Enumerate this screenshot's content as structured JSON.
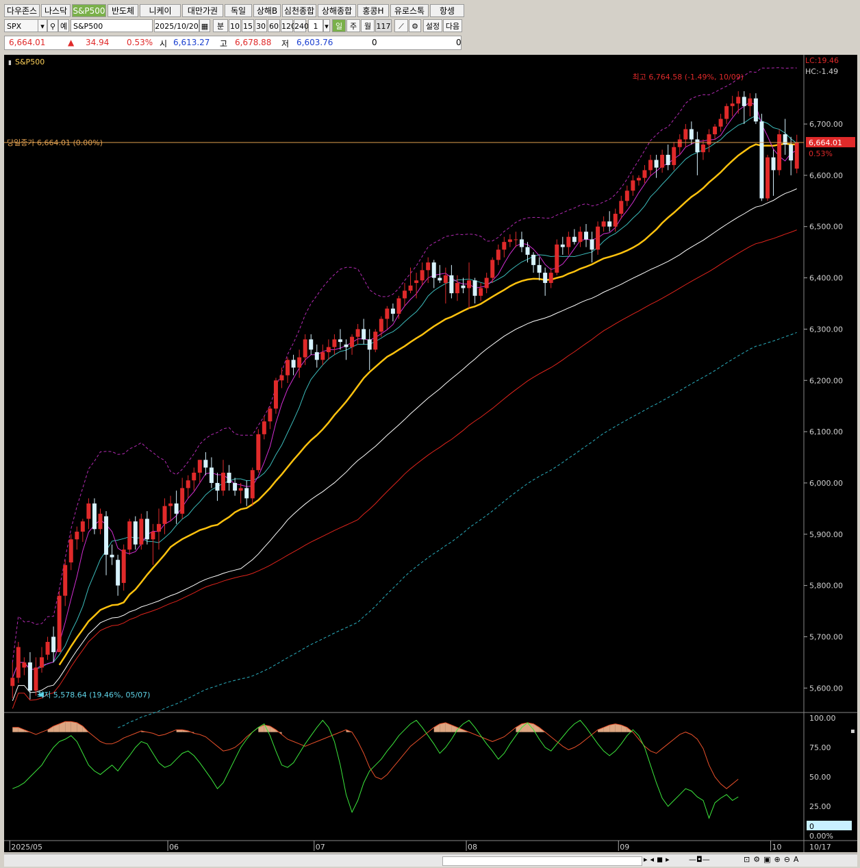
{
  "tabs": [
    "다우존스",
    "나스닥",
    "S&P500",
    "반도체",
    "니케이",
    "대만가권",
    "독일",
    "상해B",
    "심천종합",
    "상해종합",
    "홍콩H",
    "유로스톡",
    "항셍"
  ],
  "active_tab": "S&P500",
  "toolbar": {
    "symbol_code": "SPX",
    "symbol_name": "S&P500",
    "date": "2025/10/20",
    "periods": [
      "분",
      "10",
      "15",
      "30",
      "60",
      "120",
      "240"
    ],
    "period_count": "1",
    "day_label": "일",
    "week_label": "주",
    "month_label": "월",
    "bar_count": "117",
    "settings_label": "설정",
    "next_label": "다음",
    "prefix_label": "예"
  },
  "quote": {
    "price": "6,664.01",
    "change": "34.94",
    "change_pct": "0.53%",
    "open_label": "시",
    "open": "6,613.27",
    "high_label": "고",
    "high": "6,678.88",
    "low_label": "저",
    "low": "6,603.76",
    "vol1": "0",
    "vol2": "0"
  },
  "chart_data": {
    "type": "candlestick",
    "title": "S&P500",
    "lc_label": "LC:19.46",
    "hc_label": "HC:-1.49",
    "max_annotation": "최고 6,764.58 (-1.49%, 10/09)",
    "min_annotation": "최저 5,578.64 (19.46%, 05/07)",
    "close_line_label": "당일종가 6,664.01 (0.00%)",
    "last_price_tag": "6,664.01",
    "last_pct_tag": "0.53%",
    "y_ticks": [
      "6,700.00",
      "6,600.00",
      "6,500.00",
      "6,400.00",
      "6,300.00",
      "6,200.00",
      "6,100.00",
      "6,000.00",
      "5,900.00",
      "5,800.00",
      "5,700.00",
      "5,600.00"
    ],
    "y_tick_values": [
      6700,
      6600,
      6500,
      6400,
      6300,
      6200,
      6100,
      6000,
      5900,
      5800,
      5700,
      5600
    ],
    "ylim": [
      5555,
      6835
    ],
    "x_labels": [
      "2025/05",
      "06",
      "07",
      "08",
      "09",
      "10",
      "10/17"
    ],
    "x_label_index": [
      0,
      27,
      52,
      78,
      104,
      130,
      147
    ],
    "candles": [
      [
        5604,
        5650,
        5580,
        5620
      ],
      [
        5620,
        5690,
        5610,
        5680
      ],
      [
        5640,
        5660,
        5625,
        5650
      ],
      [
        5650,
        5670,
        5578,
        5595
      ],
      [
        5595,
        5660,
        5585,
        5640
      ],
      [
        5640,
        5680,
        5630,
        5660
      ],
      [
        5665,
        5700,
        5655,
        5690
      ],
      [
        5700,
        5720,
        5650,
        5670
      ],
      [
        5670,
        5790,
        5670,
        5780
      ],
      [
        5780,
        5850,
        5760,
        5840
      ],
      [
        5845,
        5900,
        5830,
        5890
      ],
      [
        5890,
        5915,
        5870,
        5905
      ],
      [
        5905,
        5930,
        5885,
        5925
      ],
      [
        5930,
        5970,
        5910,
        5960
      ],
      [
        5960,
        5970,
        5900,
        5910
      ],
      [
        5910,
        5950,
        5900,
        5940
      ],
      [
        5935,
        5945,
        5820,
        5860
      ],
      [
        5860,
        5880,
        5840,
        5855
      ],
      [
        5850,
        5860,
        5780,
        5800
      ],
      [
        5805,
        5880,
        5790,
        5870
      ],
      [
        5870,
        5930,
        5860,
        5925
      ],
      [
        5925,
        5935,
        5870,
        5880
      ],
      [
        5880,
        5940,
        5870,
        5930
      ],
      [
        5930,
        5945,
        5880,
        5890
      ],
      [
        5890,
        5920,
        5840,
        5905
      ],
      [
        5905,
        5950,
        5870,
        5920
      ],
      [
        5920,
        5970,
        5900,
        5955
      ],
      [
        5955,
        5975,
        5925,
        5960
      ],
      [
        5960,
        5985,
        5920,
        5940
      ],
      [
        5940,
        6010,
        5930,
        5990
      ],
      [
        5990,
        6015,
        5970,
        6005
      ],
      [
        6005,
        6030,
        5985,
        6020
      ],
      [
        6020,
        6045,
        6000,
        6045
      ],
      [
        6045,
        6060,
        6015,
        6030
      ],
      [
        6030,
        6050,
        5990,
        6000
      ],
      [
        6000,
        6020,
        5965,
        5985
      ],
      [
        5985,
        6045,
        5975,
        6020
      ],
      [
        6020,
        6035,
        5985,
        6000
      ],
      [
        6000,
        6010,
        5975,
        5985
      ],
      [
        5985,
        6000,
        5960,
        5990
      ],
      [
        5990,
        6005,
        5955,
        5970
      ],
      [
        5970,
        6030,
        5955,
        6025
      ],
      [
        6025,
        6105,
        6020,
        6095
      ],
      [
        6095,
        6130,
        6085,
        6120
      ],
      [
        6120,
        6150,
        6105,
        6145
      ],
      [
        6145,
        6205,
        6135,
        6200
      ],
      [
        6200,
        6225,
        6185,
        6210
      ],
      [
        6210,
        6245,
        6195,
        6240
      ],
      [
        6240,
        6250,
        6210,
        6225
      ],
      [
        6225,
        6260,
        6205,
        6245
      ],
      [
        6245,
        6290,
        6230,
        6280
      ],
      [
        6280,
        6290,
        6250,
        6260
      ],
      [
        6255,
        6270,
        6225,
        6240
      ],
      [
        6240,
        6270,
        6230,
        6255
      ],
      [
        6255,
        6280,
        6240,
        6265
      ],
      [
        6265,
        6290,
        6250,
        6280
      ],
      [
        6280,
        6300,
        6260,
        6275
      ],
      [
        6270,
        6280,
        6240,
        6265
      ],
      [
        6265,
        6290,
        6250,
        6285
      ],
      [
        6285,
        6310,
        6270,
        6300
      ],
      [
        6300,
        6320,
        6270,
        6280
      ],
      [
        6280,
        6300,
        6220,
        6260
      ],
      [
        6260,
        6300,
        6255,
        6295
      ],
      [
        6295,
        6325,
        6285,
        6320
      ],
      [
        6320,
        6345,
        6300,
        6340
      ],
      [
        6340,
        6350,
        6315,
        6330
      ],
      [
        6330,
        6365,
        6320,
        6360
      ],
      [
        6360,
        6390,
        6345,
        6375
      ],
      [
        6375,
        6420,
        6370,
        6385
      ],
      [
        6390,
        6410,
        6360,
        6395
      ],
      [
        6395,
        6430,
        6385,
        6415
      ],
      [
        6415,
        6440,
        6390,
        6430
      ],
      [
        6430,
        6435,
        6380,
        6400
      ],
      [
        6400,
        6425,
        6390,
        6395
      ],
      [
        6390,
        6420,
        6350,
        6405
      ],
      [
        6405,
        6425,
        6360,
        6370
      ],
      [
        6370,
        6405,
        6355,
        6390
      ],
      [
        6385,
        6400,
        6370,
        6380
      ],
      [
        6380,
        6430,
        6340,
        6395
      ],
      [
        6395,
        6400,
        6350,
        6365
      ],
      [
        6365,
        6390,
        6355,
        6380
      ],
      [
        6380,
        6410,
        6370,
        6400
      ],
      [
        6400,
        6440,
        6390,
        6435
      ],
      [
        6435,
        6465,
        6425,
        6455
      ],
      [
        6455,
        6480,
        6440,
        6470
      ],
      [
        6470,
        6485,
        6460,
        6475
      ],
      [
        6475,
        6490,
        6460,
        6475
      ],
      [
        6475,
        6490,
        6450,
        6460
      ],
      [
        6460,
        6470,
        6430,
        6445
      ],
      [
        6445,
        6450,
        6410,
        6425
      ],
      [
        6425,
        6440,
        6395,
        6410
      ],
      [
        6410,
        6420,
        6365,
        6390
      ],
      [
        6390,
        6420,
        6380,
        6410
      ],
      [
        6410,
        6475,
        6405,
        6465
      ],
      [
        6465,
        6480,
        6445,
        6460
      ],
      [
        6460,
        6490,
        6445,
        6480
      ],
      [
        6480,
        6495,
        6465,
        6470
      ],
      [
        6470,
        6500,
        6460,
        6490
      ],
      [
        6490,
        6505,
        6460,
        6475
      ],
      [
        6475,
        6490,
        6430,
        6455
      ],
      [
        6455,
        6510,
        6445,
        6500
      ],
      [
        6500,
        6520,
        6490,
        6510
      ],
      [
        6510,
        6530,
        6490,
        6500
      ],
      [
        6500,
        6535,
        6490,
        6525
      ],
      [
        6525,
        6560,
        6515,
        6550
      ],
      [
        6550,
        6580,
        6540,
        6570
      ],
      [
        6570,
        6600,
        6560,
        6590
      ],
      [
        6590,
        6600,
        6580,
        6595
      ],
      [
        6595,
        6620,
        6585,
        6610
      ],
      [
        6610,
        6640,
        6600,
        6630
      ],
      [
        6630,
        6640,
        6595,
        6615
      ],
      [
        6615,
        6650,
        6605,
        6640
      ],
      [
        6640,
        6660,
        6610,
        6620
      ],
      [
        6620,
        6665,
        6610,
        6655
      ],
      [
        6655,
        6680,
        6640,
        6670
      ],
      [
        6670,
        6700,
        6655,
        6690
      ],
      [
        6690,
        6705,
        6660,
        6670
      ],
      [
        6670,
        6685,
        6600,
        6645
      ],
      [
        6645,
        6670,
        6630,
        6660
      ],
      [
        6660,
        6690,
        6645,
        6680
      ],
      [
        6680,
        6700,
        6670,
        6695
      ],
      [
        6695,
        6720,
        6685,
        6710
      ],
      [
        6710,
        6740,
        6700,
        6735
      ],
      [
        6735,
        6755,
        6715,
        6740
      ],
      [
        6740,
        6764,
        6720,
        6753
      ],
      [
        6753,
        6764,
        6700,
        6735
      ],
      [
        6735,
        6760,
        6715,
        6750
      ],
      [
        6750,
        6760,
        6700,
        6705
      ],
      [
        6705,
        6720,
        6550,
        6555
      ],
      [
        6555,
        6640,
        6550,
        6635
      ],
      [
        6635,
        6650,
        6560,
        6610
      ],
      [
        6610,
        6690,
        6600,
        6680
      ],
      [
        6680,
        6710,
        6640,
        6660
      ],
      [
        6660,
        6675,
        6600,
        6629
      ],
      [
        6613,
        6679,
        6604,
        6664
      ]
    ],
    "oscillator": {
      "y_ticks": [
        "100.00",
        "75.00",
        "50.00",
        "25.00"
      ],
      "y_tick_values": [
        100,
        75,
        50,
        25
      ],
      "value_box": "0",
      "pct_label": "0.00%",
      "slow": [
        92,
        92,
        90,
        88,
        86,
        88,
        90,
        93,
        95,
        97,
        97,
        96,
        93,
        88,
        84,
        80,
        78,
        78,
        80,
        83,
        85,
        87,
        89,
        88,
        87,
        85,
        86,
        88,
        90,
        90,
        89,
        87,
        86,
        84,
        80,
        76,
        72,
        73,
        75,
        79,
        84,
        88,
        92,
        94,
        93,
        90,
        86,
        82,
        80,
        78,
        76,
        78,
        80,
        82,
        84,
        86,
        88,
        90,
        88,
        80,
        70,
        58,
        50,
        48,
        52,
        58,
        64,
        70,
        76,
        80,
        84,
        88,
        92,
        95,
        96,
        94,
        92,
        90,
        88,
        86,
        84,
        82,
        80,
        82,
        84,
        88,
        92,
        95,
        96,
        95,
        92,
        88,
        84,
        80,
        76,
        73,
        75,
        78,
        82,
        86,
        90,
        92,
        94,
        95,
        94,
        92,
        88,
        82,
        76,
        72,
        70,
        74,
        78,
        82,
        86,
        88,
        86,
        82,
        74,
        60,
        50,
        44,
        40,
        44,
        48
      ],
      "fast": [
        40,
        42,
        45,
        50,
        55,
        60,
        68,
        75,
        80,
        82,
        85,
        80,
        70,
        60,
        55,
        52,
        56,
        60,
        55,
        62,
        68,
        75,
        80,
        78,
        70,
        62,
        58,
        60,
        65,
        70,
        72,
        68,
        62,
        55,
        48,
        40,
        45,
        55,
        65,
        75,
        82,
        88,
        92,
        95,
        85,
        72,
        60,
        58,
        62,
        70,
        78,
        85,
        92,
        98,
        92,
        80,
        60,
        35,
        20,
        30,
        45,
        55,
        60,
        65,
        72,
        78,
        85,
        90,
        95,
        98,
        92,
        85,
        78,
        70,
        75,
        82,
        90,
        95,
        98,
        92,
        85,
        78,
        72,
        65,
        70,
        78,
        85,
        92,
        96,
        90,
        82,
        75,
        72,
        78,
        84,
        90,
        95,
        98,
        92,
        85,
        78,
        72,
        68,
        72,
        78,
        85,
        90,
        85,
        75,
        60,
        45,
        32,
        25,
        30,
        35,
        40,
        38,
        33,
        30,
        15,
        28,
        32,
        35,
        30,
        33
      ]
    }
  },
  "colors": {
    "up": "#e02a2a",
    "down": "#d7f3ff",
    "ma5": "#d42ed4",
    "ma10": "#3cbcbc",
    "ma20": "#ffc20e",
    "ma60": "#ffffff",
    "ma120": "#e0241c",
    "bollinger_upper": "#b52bb5",
    "bollinger_lower": "#2bb0c0",
    "close_line": "#e0a050",
    "axis_text": "#d0d0d0",
    "slow_line": "#e8502a",
    "fast_line": "#3ce83c",
    "overbought_fill": "#f5b890"
  }
}
